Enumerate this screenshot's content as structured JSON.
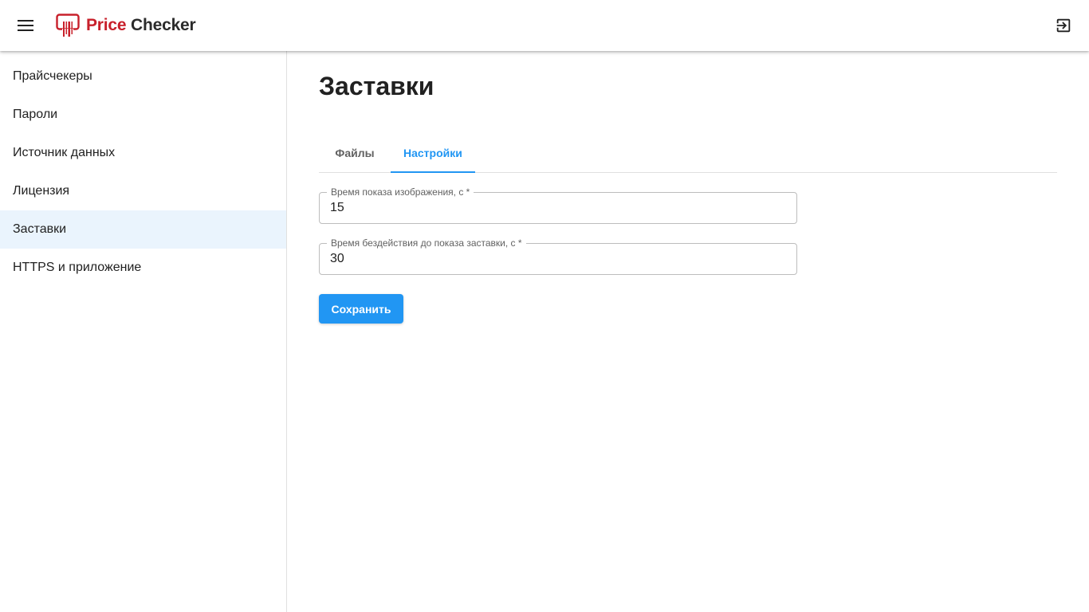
{
  "appbar": {
    "menu_icon": "hamburger-menu-icon",
    "logo": {
      "word1": "Price",
      "word2": "Checker",
      "icon": "price-checker-logo-icon",
      "color_primary": "#c8202b",
      "color_secondary": "#2b2b2b"
    },
    "exit_icon": "logout-icon"
  },
  "sidebar": {
    "items": [
      {
        "label": "Прайсчекеры"
      },
      {
        "label": "Пароли"
      },
      {
        "label": "Источник данных"
      },
      {
        "label": "Лицензия"
      },
      {
        "label": "Заставки",
        "active": true
      },
      {
        "label": "HTTPS и приложение"
      }
    ],
    "active_bg": "#eaf4fd"
  },
  "main": {
    "title": "Заставки",
    "tabs": [
      {
        "label": "Файлы"
      },
      {
        "label": "Настройки",
        "active": true
      }
    ],
    "fields": [
      {
        "label": "Время показа изображения, с *",
        "value": "15"
      },
      {
        "label": "Время бездействия до показа заставки, с *",
        "value": "30"
      }
    ],
    "save_label": "Сохранить",
    "accent_color": "#2196f3"
  }
}
